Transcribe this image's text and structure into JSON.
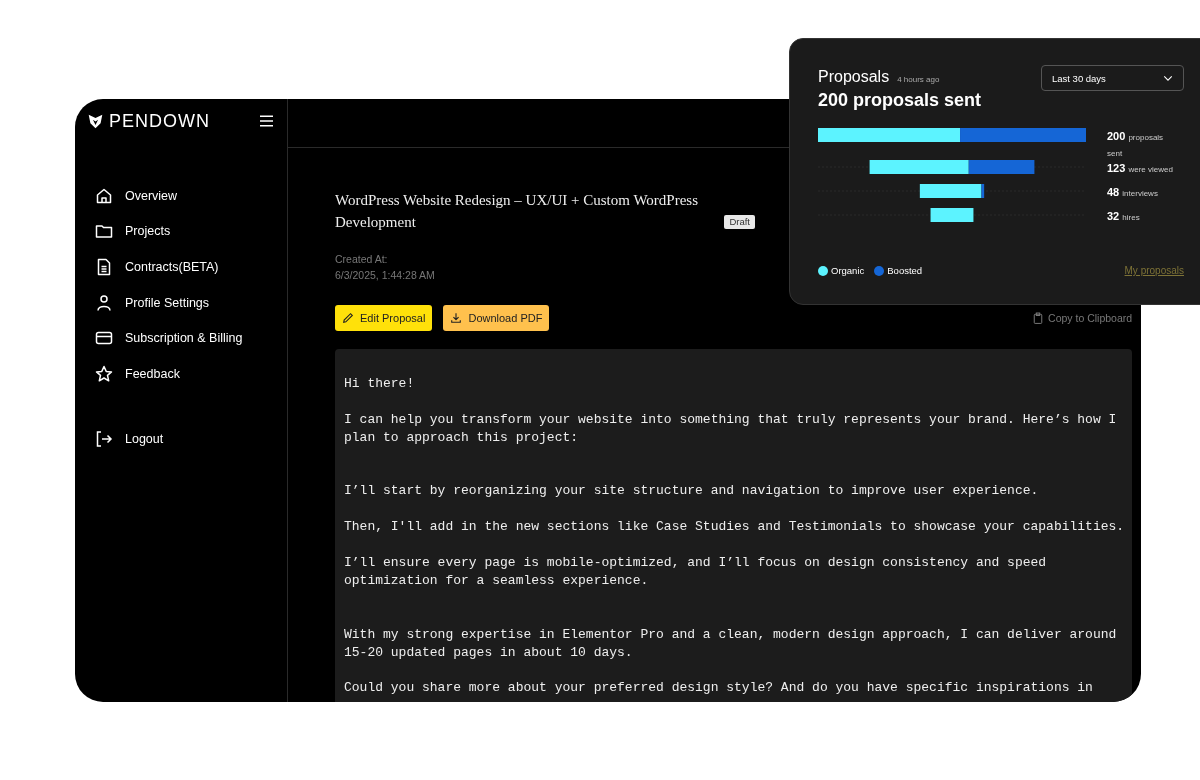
{
  "sidebar": {
    "logo": "PENDOWN",
    "items": [
      {
        "label": "Overview"
      },
      {
        "label": "Projects"
      },
      {
        "label": "Contracts(BETA)"
      },
      {
        "label": "Profile Settings"
      },
      {
        "label": "Subscription & Billing"
      },
      {
        "label": "Feedback"
      }
    ],
    "logout": "Logout"
  },
  "proposal": {
    "title": "WordPress Website Redesign – UX/UI + Custom WordPress Development",
    "status": "Draft",
    "created_label": "Created At:",
    "created_value": "6/3/2025, 1:44:28 AM",
    "buttons": [
      {
        "label": "Edit Proposal",
        "kind": "edit"
      },
      {
        "label": "Download PDF",
        "kind": "download"
      }
    ],
    "copy": "Copy to Clipboard",
    "body": "Hi there!\n\nI can help you transform your website into something that truly represents your brand. Here’s how I\nplan to approach this project:\n\n\nI’ll start by reorganizing your site structure and navigation to improve user experience.\n\nThen, I'll add in the new sections like Case Studies and Testimonials to showcase your capabilities.\n\nI’ll ensure every page is mobile-optimized, and I’ll focus on design consistency and speed\noptimization for a seamless experience.\n\n\nWith my strong expertise in Elementor Pro and a clean, modern design approach, I can deliver around\n15-20 updated pages in about 10 days.\n\nCould you share more about your preferred design style? And do you have specific inspirations in"
  },
  "stats": {
    "title": "Proposals",
    "updated": "4 hours ago",
    "headline": "200 proposals sent",
    "range": "Last 30 days",
    "stages": [
      {
        "count": "200",
        "label": "proposals sent"
      },
      {
        "count": "123",
        "label": "were viewed"
      },
      {
        "count": "48",
        "label": "interviews"
      },
      {
        "count": "32",
        "label": "hires"
      }
    ],
    "legend": [
      {
        "name": "Organic",
        "color": "#5cf3ff"
      },
      {
        "name": "Boosted",
        "color": "#1566d6"
      }
    ],
    "link": "My proposals"
  }
}
